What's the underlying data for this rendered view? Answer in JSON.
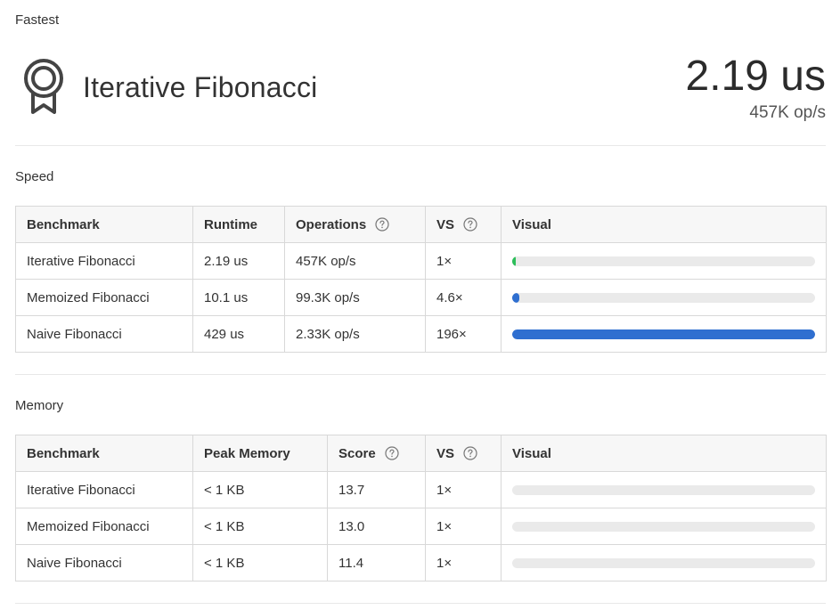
{
  "fastest": {
    "label": "Fastest",
    "name": "Iterative Fibonacci",
    "value": "2.19 us",
    "ops": "457K op/s",
    "icon": "award-ribbon-icon"
  },
  "speed": {
    "label": "Speed",
    "headers": {
      "benchmark": "Benchmark",
      "runtime": "Runtime",
      "operations": "Operations",
      "vs": "VS",
      "visual": "Visual"
    },
    "rows": [
      {
        "benchmark": "Iterative Fibonacci",
        "runtime": "2.19 us",
        "operations": "457K op/s",
        "vs": "1×",
        "fraction": 0.005,
        "color": "#2dbe5a"
      },
      {
        "benchmark": "Memoized Fibonacci",
        "runtime": "10.1 us",
        "operations": "99.3K op/s",
        "vs": "4.6×",
        "fraction": 0.024,
        "color": "#2f6fd0"
      },
      {
        "benchmark": "Naive Fibonacci",
        "runtime": "429 us",
        "operations": "2.33K op/s",
        "vs": "196×",
        "fraction": 1.0,
        "color": "#2f6fd0"
      }
    ]
  },
  "memory": {
    "label": "Memory",
    "headers": {
      "benchmark": "Benchmark",
      "peak": "Peak Memory",
      "score": "Score",
      "vs": "VS",
      "visual": "Visual"
    },
    "rows": [
      {
        "benchmark": "Iterative Fibonacci",
        "peak": "< 1 KB",
        "score": "13.7",
        "vs": "1×",
        "fraction": 0,
        "color": "#2f6fd0"
      },
      {
        "benchmark": "Memoized Fibonacci",
        "peak": "< 1 KB",
        "score": "13.0",
        "vs": "1×",
        "fraction": 0,
        "color": "#2f6fd0"
      },
      {
        "benchmark": "Naive Fibonacci",
        "peak": "< 1 KB",
        "score": "11.4",
        "vs": "1×",
        "fraction": 0,
        "color": "#2f6fd0"
      }
    ]
  }
}
